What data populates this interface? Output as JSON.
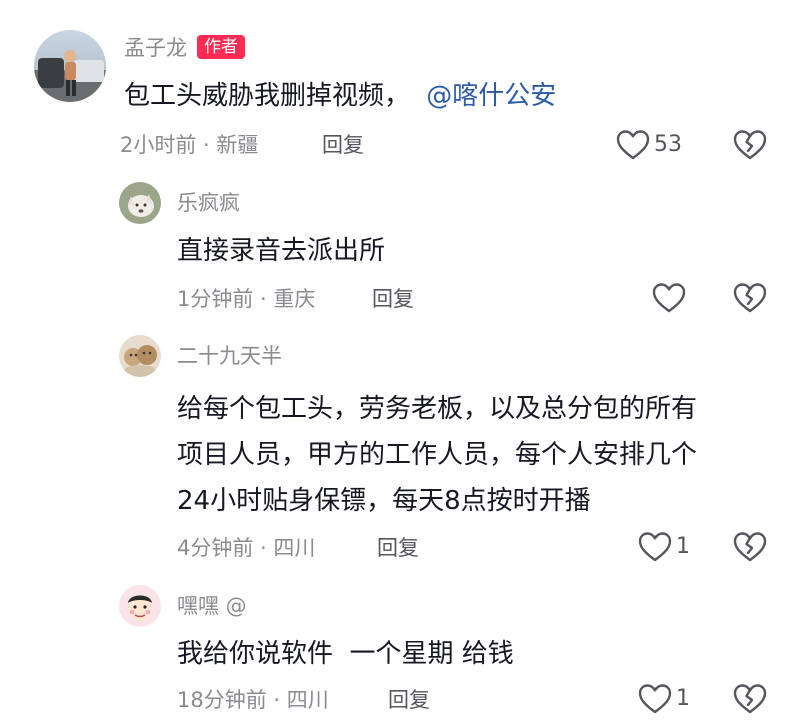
{
  "comments": [
    {
      "username": "孟子龙",
      "badge": "作者",
      "text": "包工头威胁我删掉视频，",
      "mention": "@喀什公安",
      "time_location": "2小时前 · 新疆",
      "reply_label": "回复",
      "like_count": "53"
    },
    {
      "username": "乐疯疯",
      "text": "直接录音去派出所",
      "time_location": "1分钟前 · 重庆",
      "reply_label": "回复",
      "like_count": ""
    },
    {
      "username": "二十九天半",
      "text_lines": [
        "给每个包工头，劳务老板，以及总分包的所有",
        "项目人员，甲方的工作人员，每个人安排几个",
        "24小时贴身保镖，每天8点按时开播"
      ],
      "time_location": "4分钟前 · 四川",
      "reply_label": "回复",
      "like_count": "1"
    },
    {
      "username": "嘿嘿 @",
      "text": "我给你说软件  一个星期 给钱",
      "time_location": "18分钟前 · 四川",
      "reply_label": "回复",
      "like_count": "1"
    }
  ],
  "icons": {
    "like": "heart-outline-icon",
    "dislike": "broken-heart-icon"
  },
  "colors": {
    "badge": "#fe2c55",
    "mention": "#2b5aa8",
    "secondary_text": "#8a8b91",
    "primary_text": "#161823"
  }
}
